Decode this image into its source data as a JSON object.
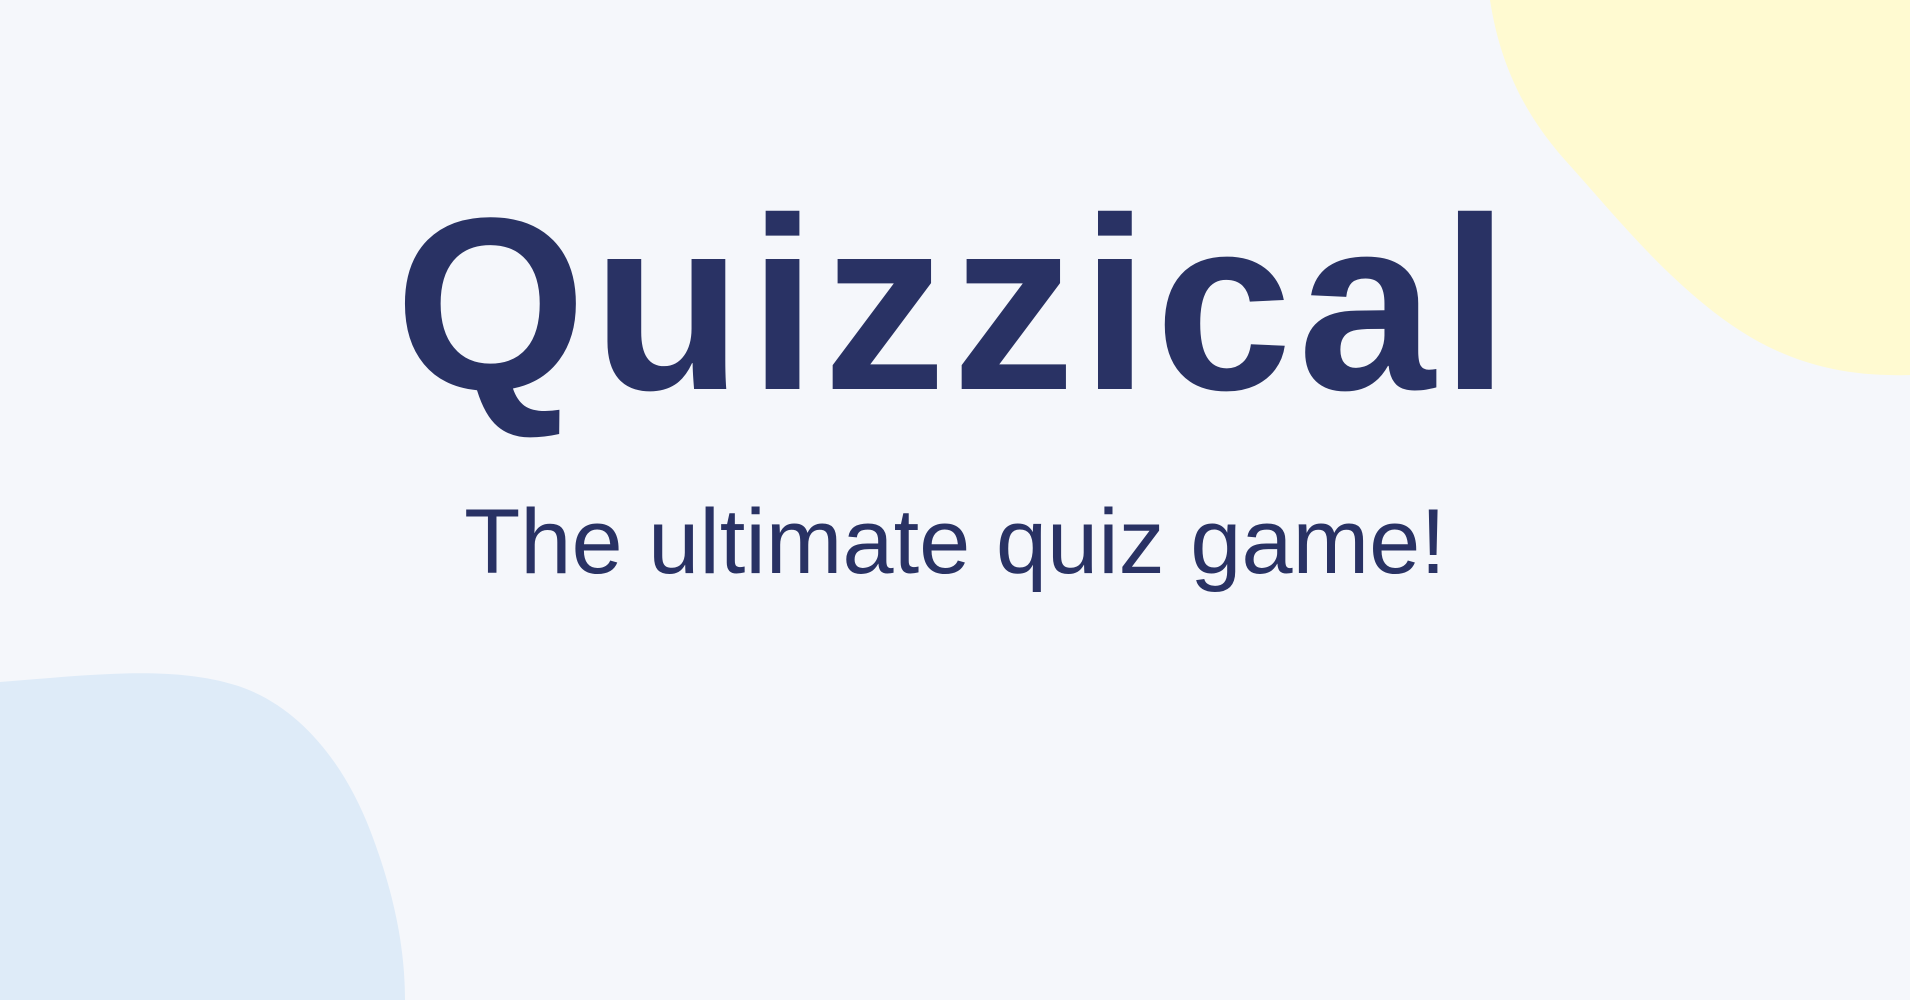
{
  "app": {
    "title": "Quizzical",
    "subtitle": "The ultimate quiz game!"
  },
  "colors": {
    "background": "#F5F7FB",
    "text": "#293264",
    "blob_yellow": "#FFFAD1",
    "blob_blue": "#DEEBF8"
  }
}
